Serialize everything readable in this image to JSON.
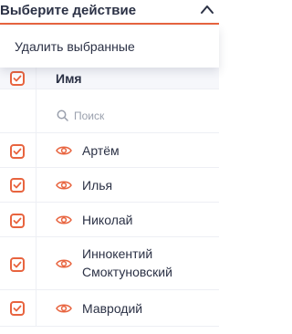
{
  "action_select": {
    "label": "Выберите действие"
  },
  "dropdown": {
    "items": [
      "Удалить выбранные"
    ]
  },
  "table": {
    "header": {
      "checked": true,
      "column_name": "Имя"
    },
    "search": {
      "placeholder": "Поиск"
    },
    "rows": [
      {
        "checked": true,
        "name": "Артём"
      },
      {
        "checked": true,
        "name": "Илья"
      },
      {
        "checked": true,
        "name": "Николай"
      },
      {
        "checked": true,
        "name": "Иннокентий Смоктуновский"
      },
      {
        "checked": true,
        "name": "Мавродий"
      }
    ]
  },
  "colors": {
    "accent": "#e8643f",
    "text": "#2b3145",
    "muted": "#9aa0ad",
    "border": "#edeff4"
  },
  "icons": {
    "chevron": "chevron-up-icon",
    "row_icon": "eye-icon",
    "search": "search-icon",
    "checkbox": "checkmark-icon"
  }
}
